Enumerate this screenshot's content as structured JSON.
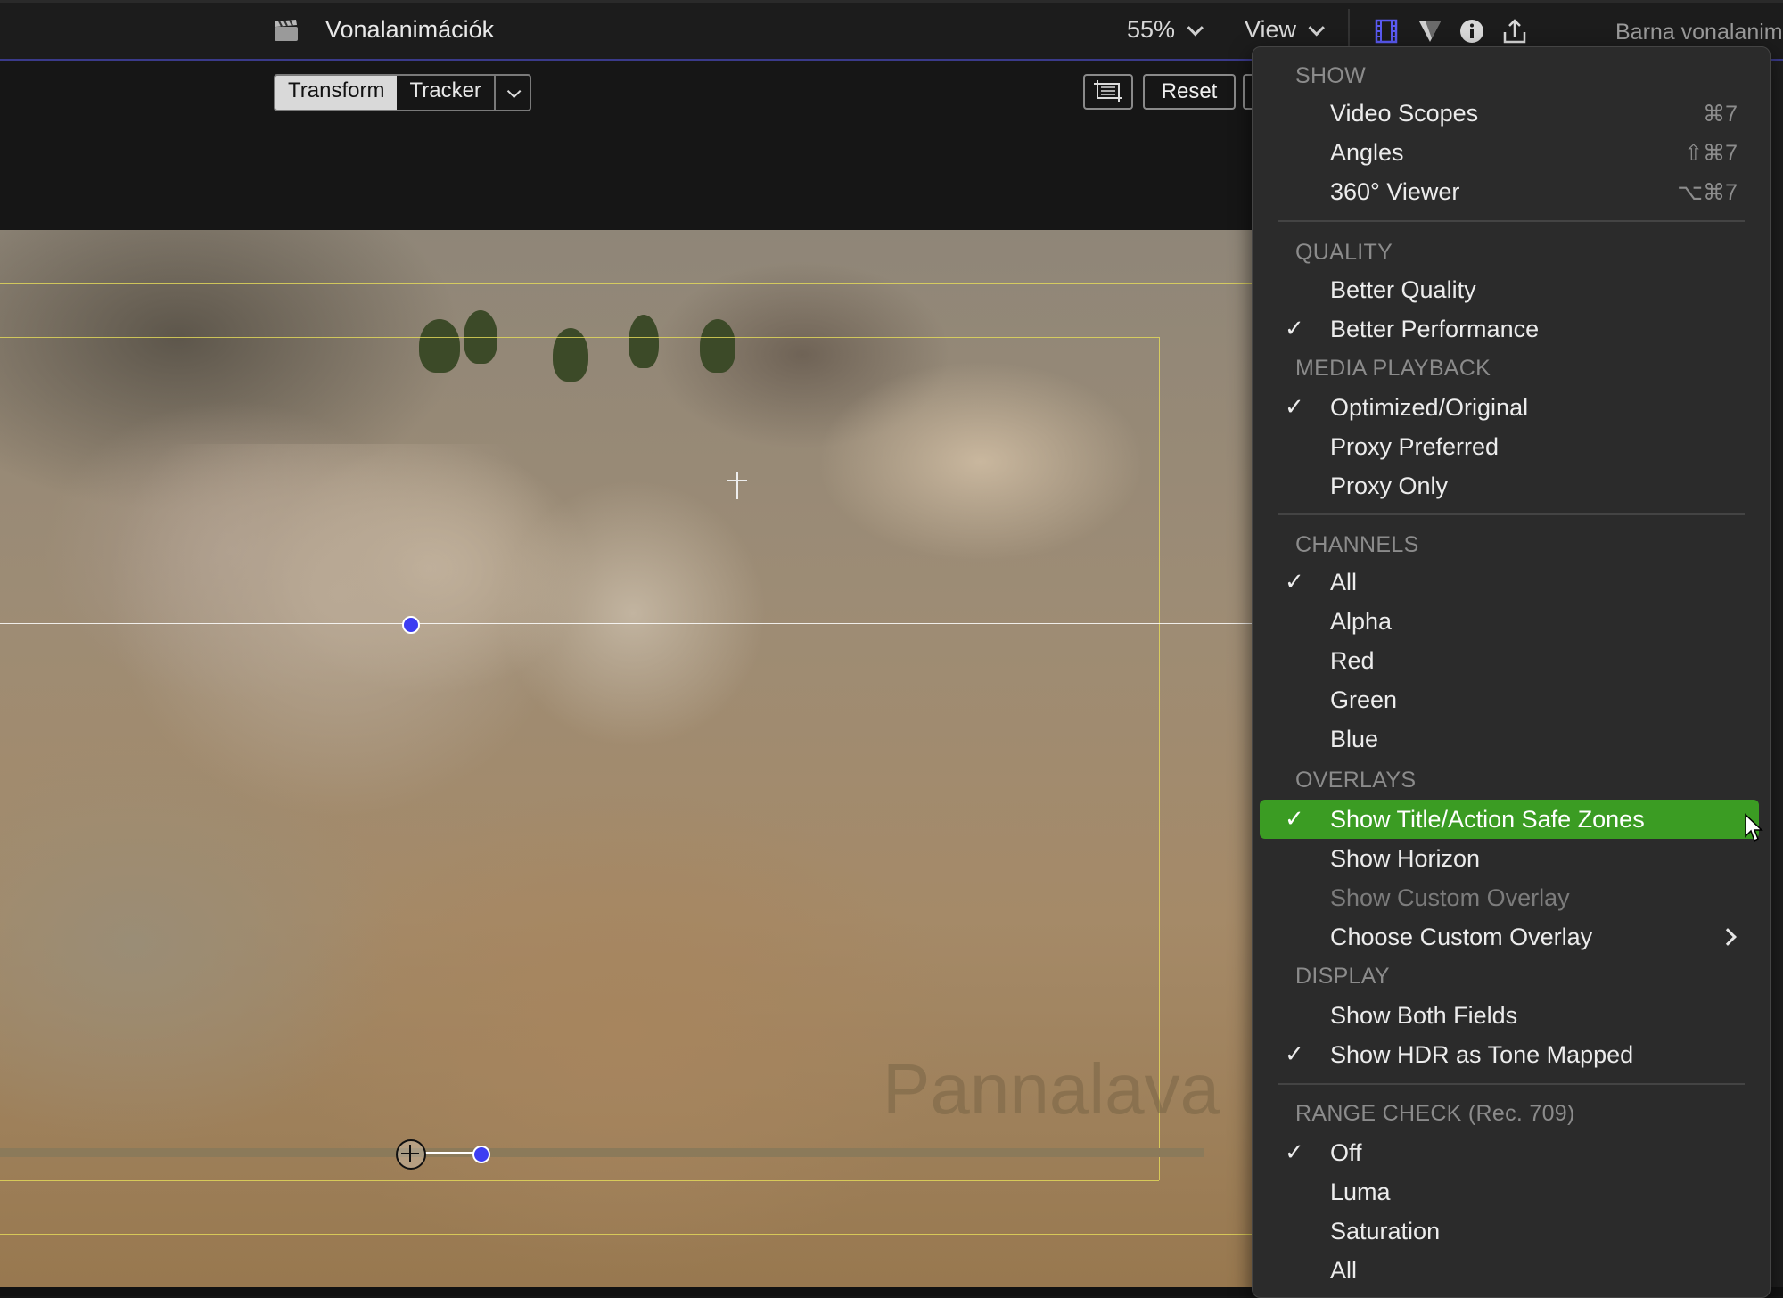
{
  "toolbar": {
    "title": "Vonalanimációk",
    "zoom": "55%",
    "view_label": "View",
    "project_name": "Barna vonalanimáció",
    "icons": [
      "film-icon",
      "color-board-icon",
      "info-icon",
      "share-icon"
    ]
  },
  "subtoolbar": {
    "transform_label": "Transform",
    "tracker_label": "Tracker",
    "reset_label": "Reset"
  },
  "viewer": {
    "watermark_text": "Pannalava"
  },
  "menu": {
    "sections": {
      "show": "SHOW",
      "quality": "QUALITY",
      "media_playback": "MEDIA PLAYBACK",
      "channels": "CHANNELS",
      "overlays": "OVERLAYS",
      "display": "DISPLAY",
      "range_check": "RANGE CHECK (Rec. 709)"
    },
    "items": {
      "video_scopes": {
        "label": "Video Scopes",
        "shortcut": "⌘7"
      },
      "angles": {
        "label": "Angles",
        "shortcut": "⇧⌘7"
      },
      "viewer_360": {
        "label": "360° Viewer",
        "shortcut": "⌥⌘7"
      },
      "better_quality": {
        "label": "Better Quality"
      },
      "better_performance": {
        "label": "Better Performance",
        "checked": true
      },
      "optimized_original": {
        "label": "Optimized/Original",
        "checked": true
      },
      "proxy_preferred": {
        "label": "Proxy Preferred"
      },
      "proxy_only": {
        "label": "Proxy Only"
      },
      "channels_all": {
        "label": "All",
        "checked": true
      },
      "alpha": {
        "label": "Alpha"
      },
      "red": {
        "label": "Red"
      },
      "green": {
        "label": "Green"
      },
      "blue": {
        "label": "Blue"
      },
      "safe_zones": {
        "label": "Show Title/Action Safe Zones",
        "checked": true
      },
      "show_horizon": {
        "label": "Show Horizon"
      },
      "custom_overlay": {
        "label": "Show Custom Overlay",
        "disabled": true
      },
      "choose_custom_overlay": {
        "label": "Choose Custom Overlay"
      },
      "both_fields": {
        "label": "Show Both Fields"
      },
      "hdr_tone_mapped": {
        "label": "Show HDR as Tone Mapped",
        "checked": true
      },
      "range_off": {
        "label": "Off",
        "checked": true
      },
      "range_luma": {
        "label": "Luma"
      },
      "range_saturation": {
        "label": "Saturation"
      },
      "range_all": {
        "label": "All"
      }
    },
    "check_glyph": "✓",
    "highlight_color": "#3b9c23"
  }
}
